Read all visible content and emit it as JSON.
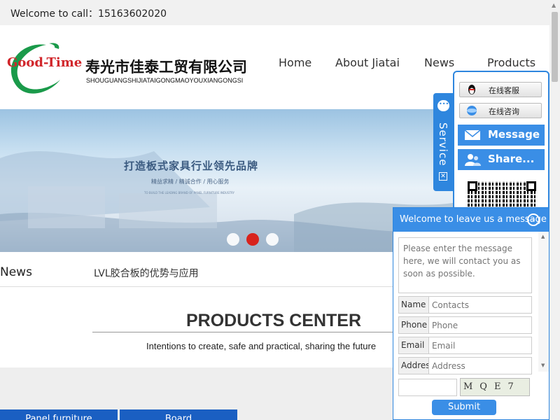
{
  "topbar": {
    "welcome": "Welcome to call：15163602020"
  },
  "logo": {
    "brand_en": "Good-Time",
    "brand_cn": "寿光市佳泰工贸有限公司",
    "brand_pinyin": "SHOUGUANGSHIJIATAIGONGMAOYOUXIANGONGSI"
  },
  "nav": [
    {
      "label": "Home"
    },
    {
      "label": "About Jiatai"
    },
    {
      "label": "News"
    },
    {
      "label": "Products"
    }
  ],
  "banner": {
    "title": "打造板式家具行业领先品牌",
    "subtitle": "精益求精 / 精诚合作 / 用心服务",
    "small": "TO BUILD THE LEADING BRAND OF PANEL FURNITURE INDUSTRY",
    "slides": 3,
    "active_slide": 2
  },
  "news": {
    "label": "News",
    "headline": "LVL胶合板的优势与应用"
  },
  "products": {
    "title": "PRODUCTS CENTER",
    "tagline": "Intentions to create, safe and practical, sharing the future"
  },
  "categories": [
    {
      "label": "Panel furniture"
    },
    {
      "label": "Board"
    }
  ],
  "service": {
    "tab_label": "Service",
    "qq_buttons": [
      {
        "label": "在线客服"
      },
      {
        "label": "在线咨询"
      }
    ],
    "message_label": "Message",
    "share_label": "Share..."
  },
  "message_box": {
    "header": "Welcome to leave us a message",
    "textarea_placeholder": "Please enter the message here, we will contact you as soon as possible.",
    "fields": [
      {
        "label": "Name",
        "placeholder": "Contacts"
      },
      {
        "label": "Phone",
        "placeholder": "Phone"
      },
      {
        "label": "Email",
        "placeholder": "Email"
      },
      {
        "label": "Addres",
        "placeholder": "Address"
      }
    ],
    "captcha_text": "MQE7",
    "submit_label": "Submit"
  },
  "colors": {
    "accent": "#3a8ee6",
    "brand_red": "#d1262b",
    "brand_green": "#1a9a4a",
    "category_blue": "#1a5fc2",
    "active_dot": "#d8231d"
  }
}
